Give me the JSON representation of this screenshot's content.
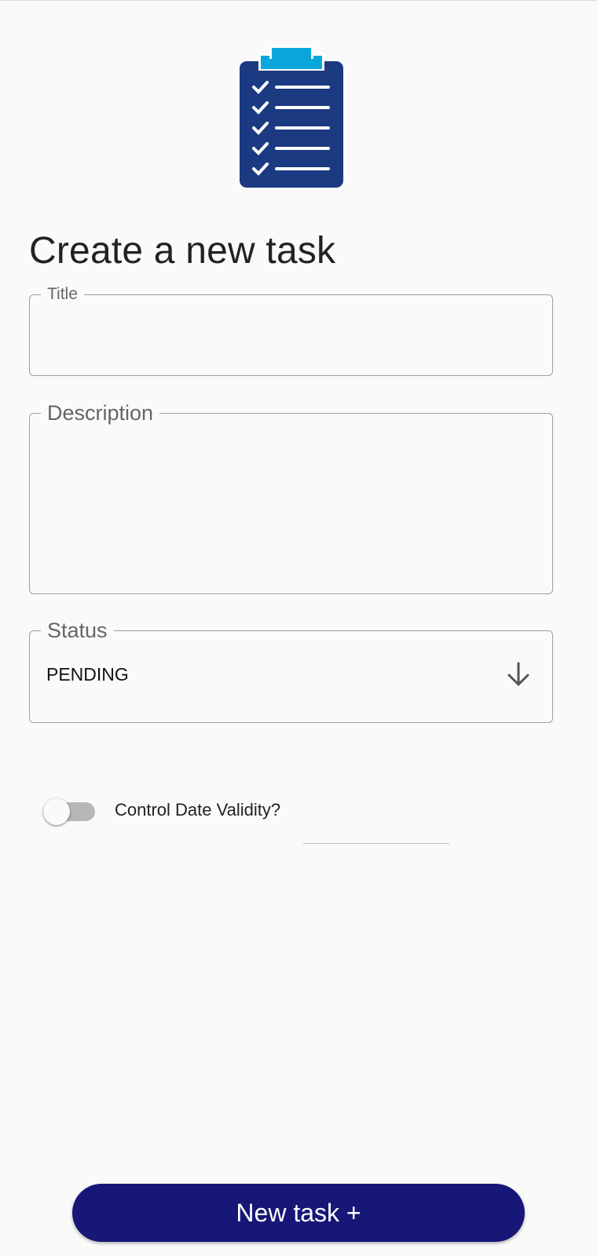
{
  "page": {
    "title": "Create a new task"
  },
  "form": {
    "title_field": {
      "label": "Title",
      "value": ""
    },
    "description_field": {
      "label": "Description",
      "value": ""
    },
    "status_field": {
      "label": "Status",
      "value": "PENDING"
    },
    "date_validity_toggle": {
      "label": "Control Date Validity?",
      "checked": false
    }
  },
  "actions": {
    "new_task_label": "New task +"
  },
  "colors": {
    "primary_button": "#171777",
    "clipboard_body": "#1b3a82",
    "clipboard_clip": "#0aa7dc",
    "background": "#fafafa"
  },
  "icons": {
    "logo": "clipboard-checklist-icon",
    "dropdown": "arrow-down-icon"
  }
}
